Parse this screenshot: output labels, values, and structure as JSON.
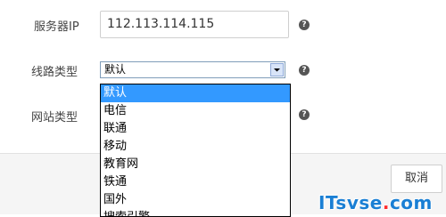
{
  "form": {
    "server_ip_label": "服务器IP",
    "server_ip_value": "112.113.114.115",
    "line_type_label": "线路类型",
    "line_type_selected": "默认",
    "site_type_label": "网站类型",
    "help_glyph": "?"
  },
  "dropdown": {
    "options": [
      "默认",
      "电信",
      "联通",
      "移动",
      "教育网",
      "铁通",
      "国外",
      "搜索引擎"
    ],
    "highlighted_index": 0
  },
  "footer": {
    "cancel_label": "取消"
  },
  "watermark": {
    "text_main": "ITsvse",
    "text_dot": ".",
    "text_tail": "com"
  },
  "colors": {
    "highlight": "#3399ff",
    "watermark_blue": "#1a7fd4",
    "watermark_red": "#ff2d2d"
  }
}
